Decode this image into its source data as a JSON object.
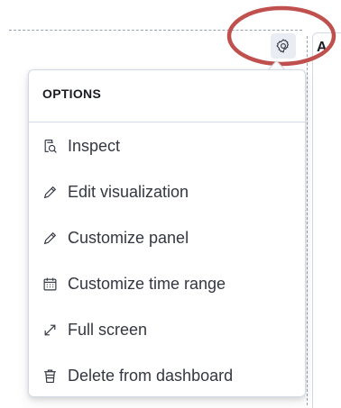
{
  "popover": {
    "title": "OPTIONS",
    "items": [
      {
        "label": "Inspect",
        "icon": "inspect-icon"
      },
      {
        "label": "Edit visualization",
        "icon": "pencil-icon"
      },
      {
        "label": "Customize panel",
        "icon": "pencil-icon"
      },
      {
        "label": "Customize time range",
        "icon": "calendar-icon"
      },
      {
        "label": "Full screen",
        "icon": "expand-icon"
      },
      {
        "label": "Delete from dashboard",
        "icon": "trash-icon"
      }
    ]
  },
  "toolbar": {
    "gear_icon": "gear-icon"
  },
  "adjacent_panel": {
    "visible_char": "A"
  },
  "colors": {
    "annotation": "#c0504d",
    "text": "#343741",
    "border": "#d3dae6",
    "button_bg": "#e9edf3"
  }
}
